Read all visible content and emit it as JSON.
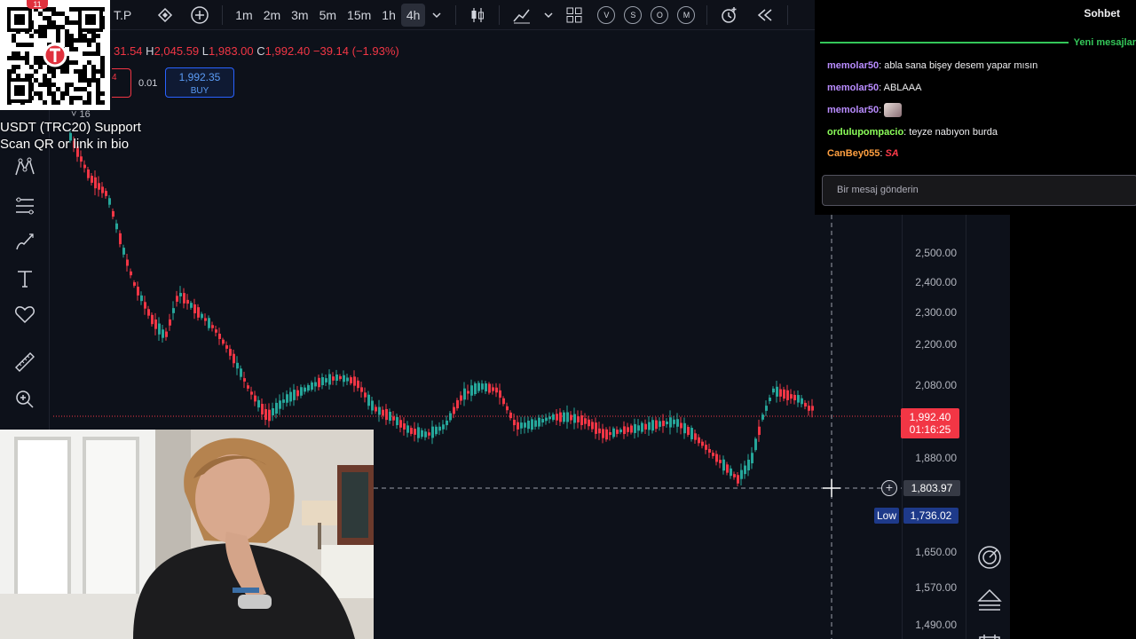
{
  "toolbar": {
    "symbol_fragment": "T.P",
    "timeframes": [
      "1m",
      "2m",
      "3m",
      "5m",
      "15m",
      "1h",
      "4h"
    ],
    "active_timeframe": "4h",
    "circle_buttons": [
      "V",
      "S",
      "O",
      "M"
    ],
    "notification_count": "11"
  },
  "ohlc": {
    "o_value": "31.54",
    "h_key": "H",
    "h_value": "2,045.59",
    "l_key": "L",
    "l_value": "1,983.00",
    "c_key": "C",
    "c_value": "1,992.40",
    "change": "−39.14 (−1.93%)"
  },
  "trade": {
    "sell_fragment": "4",
    "lot": "0.01",
    "buy_price": "1,992.35",
    "buy_label": "BUY"
  },
  "indicator_count": "16",
  "price_axis": {
    "ticks": [
      "2,500.00",
      "2,400.00",
      "2,300.00",
      "2,200.00",
      "2,080.00",
      "1,880.00",
      "1,650.00",
      "1,570.00",
      "1,490.00"
    ],
    "last_price": "1,992.40",
    "countdown": "01:16:25",
    "crosshair_price": "1,803.97",
    "low_label": "Low",
    "low_price": "1,736.02"
  },
  "colors": {
    "up": "#26a69a",
    "down": "#f23645",
    "background": "#0d111a",
    "accent_blue": "#2962ff"
  },
  "chat": {
    "title": "Sohbet",
    "new_messages": "Yeni mesajlar",
    "messages": [
      {
        "user": "memolar50",
        "text": "abla sana bişey desem yapar mısın",
        "color": "#b98cff"
      },
      {
        "user": "memolar50",
        "text": "ABLAAA",
        "color": "#b98cff"
      },
      {
        "user": "memolar50",
        "text": "",
        "color": "#b98cff"
      },
      {
        "user": "ordulupompacio",
        "text": "teyze nabıyon burda",
        "color": "#8cff5a"
      },
      {
        "user": "CanBey055",
        "text": "",
        "color": "#ff9f40"
      }
    ],
    "emote_text": "SA",
    "input_placeholder": "Bir mesaj gönderin"
  },
  "overlay": {
    "caption_line1": "USDT (TRC20) Support",
    "caption_line2": "Scan QR or link in bio"
  }
}
